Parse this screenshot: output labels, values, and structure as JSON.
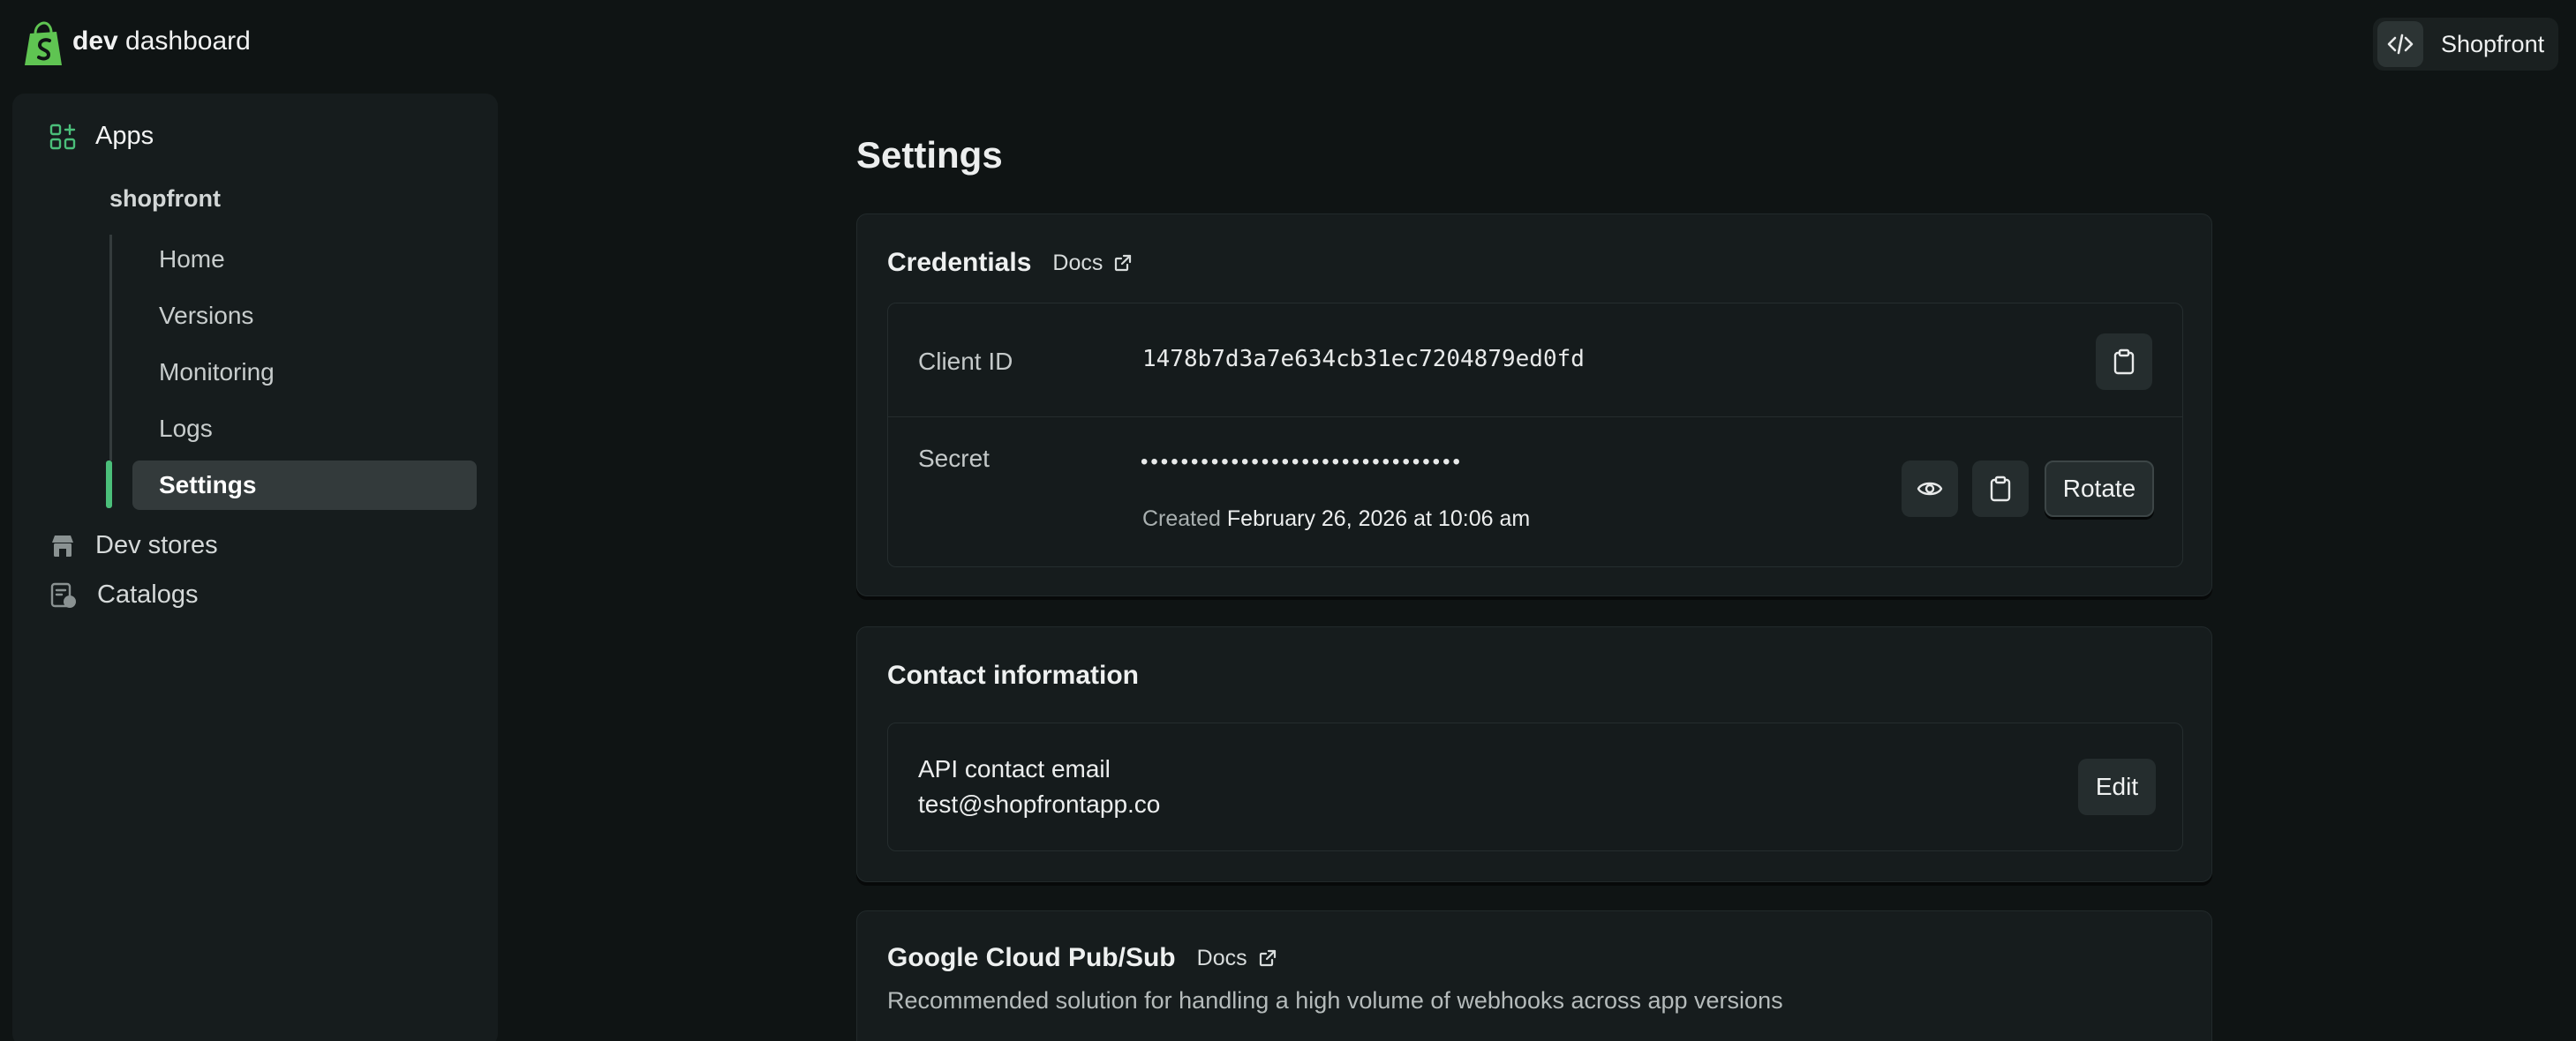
{
  "header": {
    "brand_bold": "dev",
    "brand_rest": "dashboard",
    "store_name": "Shopfront"
  },
  "sidebar": {
    "apps_label": "Apps",
    "app_name": "shopfront",
    "sub_items": [
      {
        "label": "Home"
      },
      {
        "label": "Versions"
      },
      {
        "label": "Monitoring"
      },
      {
        "label": "Logs"
      },
      {
        "label": "Settings",
        "active": true
      }
    ],
    "dev_stores_label": "Dev stores",
    "catalogs_label": "Catalogs"
  },
  "main": {
    "title": "Settings",
    "credentials": {
      "title": "Credentials",
      "docs_label": "Docs",
      "client_id_label": "Client ID",
      "client_id_value": "1478b7d3a7e634cb31ec7204879ed0fd",
      "secret_label": "Secret",
      "secret_masked": "••••••••••••••••••••••••••••••••",
      "created_prefix": "Created",
      "created_date": "February 26, 2026 at 10:06 am",
      "rotate_label": "Rotate"
    },
    "contact": {
      "title": "Contact information",
      "email_label": "API contact email",
      "email_value": "test@shopfrontapp.co",
      "edit_label": "Edit"
    },
    "pubsub": {
      "title": "Google Cloud Pub/Sub",
      "docs_label": "Docs",
      "description": "Recommended solution for handling a high volume of webhooks across app versions"
    }
  },
  "colors": {
    "background": "#0f1414",
    "panel": "#161c1d",
    "accent_green": "#4bbf7a",
    "logo_green": "#5fc452"
  },
  "icons": [
    "shopify-bag-icon",
    "code-icon",
    "apps-grid-icon",
    "store-icon",
    "catalog-icon",
    "external-link-icon",
    "clipboard-icon",
    "eye-icon"
  ]
}
